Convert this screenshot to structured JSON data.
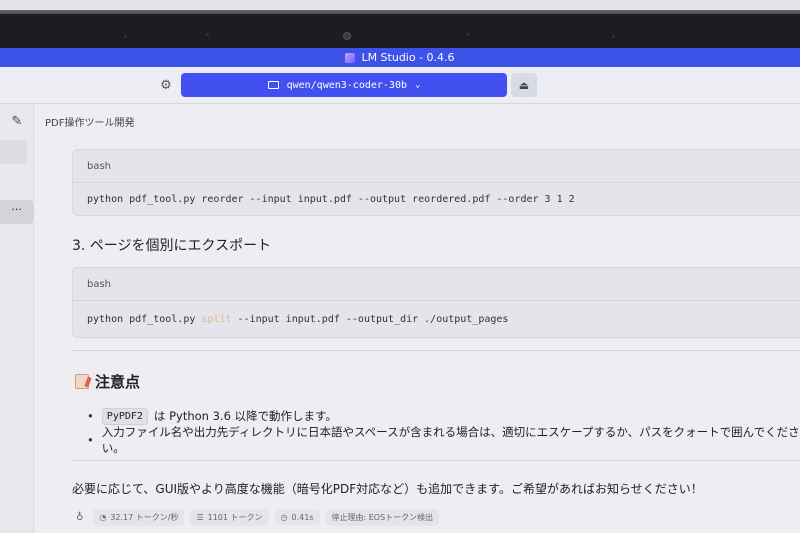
{
  "window": {
    "title": "LM Studio - 0.4.6"
  },
  "toolbar": {
    "model_name": "qwen/qwen3-coder-30b"
  },
  "chat": {
    "title": "PDF操作ツール開発",
    "code_block_1": {
      "lang": "bash",
      "code": "python pdf_tool.py reorder --input input.pdf --output reordered.pdf --order 3 1 2"
    },
    "section_3_heading": "3. ページを個別にエクスポート",
    "code_block_2": {
      "lang": "bash",
      "code_prefix": "python pdf_tool.py ",
      "code_keyword": "split",
      "code_suffix": " --input input.pdf --output_dir ./output_pages"
    },
    "notes_heading": "注意点",
    "notes": [
      {
        "code": "PyPDF2",
        "text": "は Python 3.6 以降で動作します。"
      },
      {
        "text": "入力ファイル名や出力先ディレクトリに日本語やスペースが含まれる場合は、適切にエスケープするか、パスをクォートで囲んでください。"
      }
    ],
    "closing": "必要に応じて、GUI版やより高度な機能（暗号化PDF対応など）も追加できます。ご希望があればお知らせください！",
    "stats": {
      "speed": "32.17 トークン/秒",
      "tokens": "1101 トークン",
      "time": "0.41s",
      "stop_reason": "停止理由: EOSトークン検出"
    }
  },
  "icons": {
    "settings": "gear-icon",
    "model": "monitor-icon",
    "eject": "eject-icon",
    "new_chat": "edit-icon",
    "more": "more-icon",
    "notes": "memo-icon",
    "tip": "lightbulb-icon"
  }
}
